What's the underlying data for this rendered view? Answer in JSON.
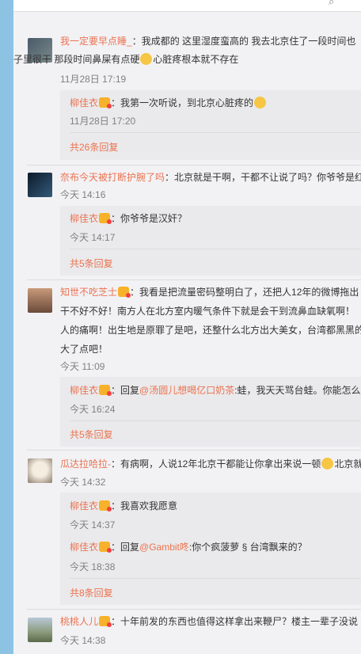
{
  "topbar": {
    "text": "...",
    "search_icon": "search-icon"
  },
  "comments": [
    {
      "user": "我一定要早点睡_",
      "line1": "：我成都的 这里湿度蛮高的  我去北京住了一段时间也",
      "line2_a": "子里很干  那段时间鼻屎有点硬",
      "line2_b": "心脏疼根本就不存在",
      "time": "11月28日 17:19",
      "replies": [
        {
          "user": "柳佳衣",
          "text": "：我第一次听说，到北京心脏疼的",
          "time": "11月28日 17:20"
        }
      ],
      "more": "共26条回复"
    },
    {
      "user": "奈布今天被打断护腕了吗",
      "line1": "：北京就是干啊，干都不让说了吗？你爷爷是红",
      "time": "今天 14:16",
      "replies": [
        {
          "user": "柳佳衣",
          "text": "：你爷爷是汉奸？",
          "time": "今天 14:17"
        }
      ],
      "more": "共5条回复"
    },
    {
      "user": "知世不吃芝士",
      "line1": "：我看是把流量密码整明白了，还把人12年的微博拖出",
      "line2": "干不好不好！南方人在北方室内暖气条件下就是会干到流鼻血缺氧啊！",
      "line3": "人的痛啊！出生地是原罪了是吧，还整什么北方出大美女，台湾都黑黑的",
      "line4": "大了点吧！",
      "time": "今天 11:09",
      "replies": [
        {
          "user": "柳佳衣",
          "prefix": "：回复",
          "mention": "@汤圆儿想喝亿口奶茶",
          "text": ":蛙，我天天骂台蛙。你能怎么",
          "time": "今天 16:24"
        }
      ],
      "more": "共5条回复"
    },
    {
      "user": "瓜达拉哈拉-",
      "line1": "：有病啊，人说12年北京干都能让你拿出来说一顿",
      "line1_b": "北京就",
      "time": "今天 14:32",
      "replies": [
        {
          "user": "柳佳衣",
          "text": "：我喜欢我愿意",
          "time": "今天 14:37"
        },
        {
          "user": "柳佳衣",
          "prefix": "：回复",
          "mention": "@Gambit咚",
          "text": ":你个疯菠萝 §  台湾飘来的？",
          "time": "今天 18:38"
        }
      ],
      "more": "共8条回复"
    },
    {
      "user": "桃桃人儿",
      "line1": "：十年前发的东西也值得这样拿出来鞭尸？楼主一辈子没说",
      "time": "今天 14:38"
    }
  ],
  "colors": {
    "name": "#eb7350",
    "time": "#808080",
    "panel": "#f2f2f5",
    "reply_bg": "#eaeaec",
    "frame": "#8cc3e3"
  }
}
